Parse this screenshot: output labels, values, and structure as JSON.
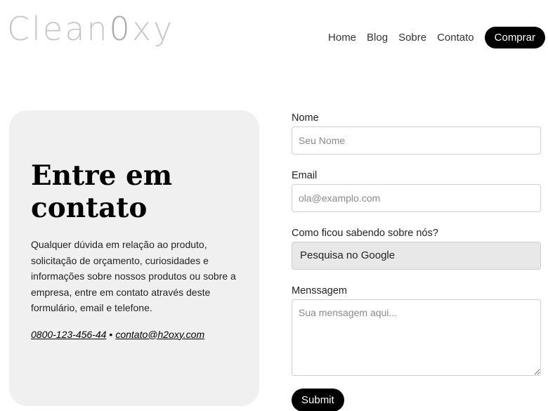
{
  "header": {
    "logo_part1": "Clean",
    "logo_part2": "0",
    "logo_part3": "xy",
    "nav": [
      "Home",
      "Blog",
      "Sobre",
      "Contato"
    ],
    "cta_label": "Comprar"
  },
  "card": {
    "title": "Entre em contato",
    "text": "Qualquer dúvida em relação ao produto, solicitação de orçamento, curiosidades e informações sobre nossos produtos ou sobre a empresa, entre em contato através deste formulário, email e telefone.",
    "phone": "0800-123-456-44",
    "separator": "•",
    "email": "contato@h2oxy.com"
  },
  "form": {
    "name_label": "Nome",
    "name_placeholder": "Seu Nome",
    "email_label": "Email",
    "email_placeholder": "ola@examplo.com",
    "source_label": "Como ficou sabendo sobre nós?",
    "source_selected": "Pesquisa no Google",
    "message_label": "Menssagem",
    "message_placeholder": "Sua mensagem aqui...",
    "submit_label": "Submit"
  },
  "colors": {
    "accent": "#000000",
    "card_bg": "#f0f0f0",
    "logo": "#c7c7c7",
    "select_bg": "#e8e8e8"
  }
}
